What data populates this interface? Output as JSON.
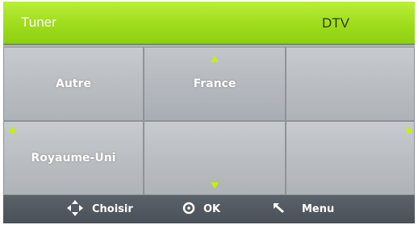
{
  "header": {
    "title": "Tuner",
    "mode": "DTV"
  },
  "grid": {
    "cells": [
      "Autre",
      "France",
      "",
      "Royaume-Uni",
      "",
      ""
    ],
    "selected_index": 1
  },
  "footer": {
    "hints": [
      {
        "label": "Choisir",
        "icon": "dpad-icon"
      },
      {
        "label": "OK",
        "icon": "ok-icon"
      },
      {
        "label": "Menu",
        "icon": "back-arrow-icon"
      }
    ]
  },
  "colors": {
    "header_green": "#a6e022",
    "arrow_green": "#c8f000",
    "footer": "#50565e"
  }
}
